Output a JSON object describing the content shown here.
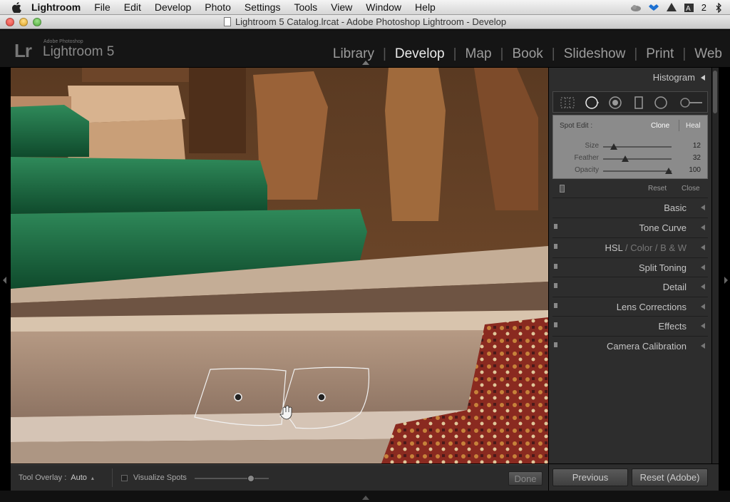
{
  "menubar": {
    "apple_icon": "apple-logo-icon",
    "items": [
      "Lightroom",
      "File",
      "Edit",
      "Develop",
      "Photo",
      "Settings",
      "Tools",
      "View",
      "Window",
      "Help"
    ],
    "badge_count": "2"
  },
  "window": {
    "title": "Lightroom 5 Catalog.lrcat - Adobe Photoshop Lightroom - Develop"
  },
  "identity": {
    "logo": "Lr",
    "small_text": "Adobe Photoshop",
    "name": "Lightroom 5"
  },
  "modules": [
    "Library",
    "Develop",
    "Map",
    "Book",
    "Slideshow",
    "Print",
    "Web"
  ],
  "active_module": "Develop",
  "right_panel": {
    "histogram_label": "Histogram",
    "spot_edit": {
      "label": "Spot Edit :",
      "clone": "Clone",
      "heal": "Heal",
      "sliders": [
        {
          "label": "Size",
          "value": "12",
          "fraction": 0.16
        },
        {
          "label": "Feather",
          "value": "32",
          "fraction": 0.32
        },
        {
          "label": "Opacity",
          "value": "100",
          "fraction": 0.96
        }
      ]
    },
    "reset_label": "Reset",
    "close_label": "Close",
    "panels": [
      {
        "label": "Basic"
      },
      {
        "label": "Tone Curve"
      },
      {
        "label": "HSL"
      },
      {
        "label": "Split Toning"
      },
      {
        "label": "Detail"
      },
      {
        "label": "Lens Corrections"
      },
      {
        "label": "Effects"
      },
      {
        "label": "Camera Calibration"
      }
    ],
    "hsl_extra": {
      "sep": "/",
      "color": "Color",
      "bw": "B & W"
    }
  },
  "toolbar": {
    "tool_overlay_label": "Tool Overlay :",
    "tool_overlay_value": "Auto",
    "visualize_label": "Visualize Spots",
    "visualize_fraction": 0.76,
    "done_label": "Done"
  },
  "bottom_buttons": {
    "previous": "Previous",
    "reset_adobe": "Reset (Adobe)"
  },
  "colors": {
    "panel_bg": "#2d2d2d",
    "spot_box_bg": "#8b8b8b",
    "carpet_green": "#1f6b43",
    "wood_brown": "#8a5a34"
  }
}
